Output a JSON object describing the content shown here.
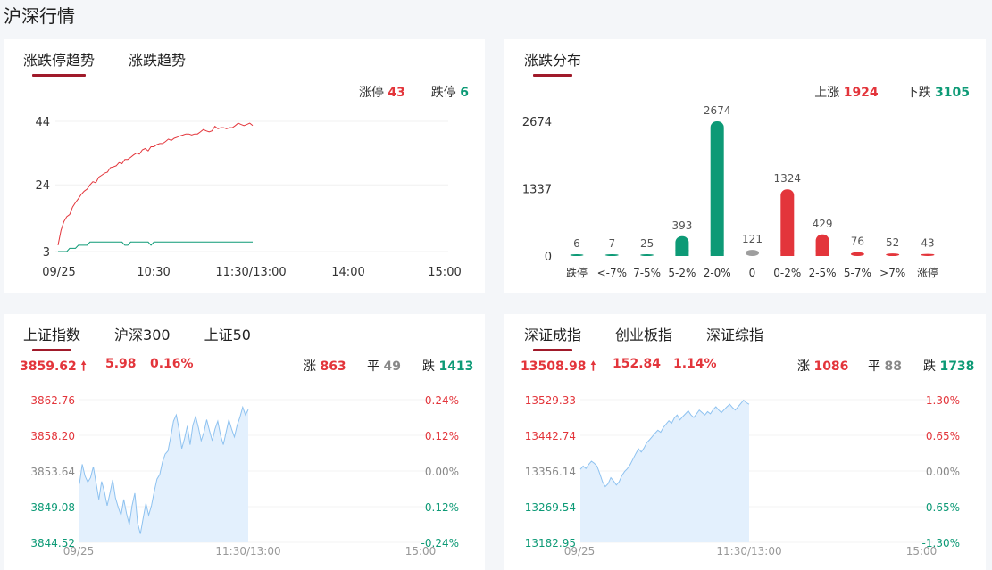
{
  "page": {
    "title": "沪深行情"
  },
  "colors": {
    "up": "#e3353b",
    "down": "#0d9a76",
    "flat": "#9e9e9e",
    "line_fill": "#e3f0fd",
    "line_stroke": "#8ec2f0"
  },
  "limit_panel": {
    "tabs": [
      {
        "label": "涨跌停趋势",
        "active": true
      },
      {
        "label": "涨跌趋势",
        "active": false
      }
    ],
    "legend": {
      "up_label": "涨停",
      "up_value": "43",
      "down_label": "跌停",
      "down_value": "6"
    },
    "chart_data": {
      "type": "line",
      "x_ticks": [
        "09/25",
        "10:30",
        "11:30/13:00",
        "14:00",
        "15:00"
      ],
      "y_ticks": [
        "44",
        "24",
        "3"
      ],
      "ylim": [
        3,
        44
      ],
      "series": [
        {
          "name": "涨停",
          "color": "#e3353b",
          "values": [
            5,
            10,
            12,
            14,
            15,
            17,
            18,
            20,
            21,
            22,
            23,
            24,
            25,
            25,
            26,
            27,
            28,
            28,
            29,
            30,
            30,
            31,
            31,
            32,
            32,
            33,
            33,
            34,
            34,
            35,
            35,
            35,
            36,
            36,
            37,
            37,
            37,
            38,
            38,
            38,
            39,
            39,
            39,
            40,
            40,
            40,
            40,
            40,
            40,
            41,
            41,
            41,
            41,
            41,
            42,
            42,
            42,
            42,
            42,
            42,
            42,
            43,
            43,
            43,
            43,
            43,
            43,
            43
          ]
        },
        {
          "name": "跌停",
          "color": "#0d9a76",
          "values": [
            3,
            3,
            3,
            3,
            4,
            4,
            4,
            5,
            5,
            5,
            5,
            6,
            6,
            6,
            6,
            6,
            6,
            6,
            6,
            6,
            6,
            6,
            6,
            5,
            5,
            6,
            6,
            6,
            6,
            6,
            6,
            6,
            5,
            6,
            6,
            6,
            6,
            6,
            6,
            6,
            6,
            6,
            6,
            6,
            6,
            6,
            6,
            6,
            6,
            6,
            6,
            6,
            6,
            6,
            6,
            6,
            6,
            6,
            6,
            6,
            6,
            6,
            6,
            6,
            6,
            6,
            6,
            6
          ]
        }
      ]
    }
  },
  "distribution_panel": {
    "tabs": [
      {
        "label": "涨跌分布",
        "active": true
      }
    ],
    "legend": {
      "up_label": "上涨",
      "up_value": "1924",
      "down_label": "下跌",
      "down_value": "3105"
    },
    "chart_data": {
      "type": "bar",
      "categories": [
        "跌停",
        "<-7%",
        "7-5%",
        "5-2%",
        "2-0%",
        "0",
        "0-2%",
        "2-5%",
        "5-7%",
        ">7%",
        "涨停"
      ],
      "values": [
        6,
        7,
        25,
        393,
        2674,
        121,
        1324,
        429,
        76,
        52,
        43
      ],
      "bar_colors": [
        "#0d9a76",
        "#0d9a76",
        "#0d9a76",
        "#0d9a76",
        "#0d9a76",
        "#9e9e9e",
        "#e3353b",
        "#e3353b",
        "#e3353b",
        "#e3353b",
        "#e3353b"
      ],
      "y_ticks": [
        "2674",
        "1337",
        "0"
      ],
      "ylim": [
        0,
        2674
      ]
    }
  },
  "sh_panel": {
    "tabs": [
      {
        "label": "上证指数",
        "active": true
      },
      {
        "label": "沪深300",
        "active": false
      },
      {
        "label": "上证50",
        "active": false
      }
    ],
    "price": "3859.62",
    "change": "5.98",
    "change_pct": "0.16%",
    "up_label": "涨",
    "up_count": "863",
    "flat_label": "平",
    "flat_count": "49",
    "down_label": "跌",
    "down_count": "1413",
    "chart_data": {
      "type": "area",
      "y_ticks_left": [
        "3862.76",
        "3858.20",
        "3853.64",
        "3849.08",
        "3844.52"
      ],
      "y_ticks_right": [
        "0.24%",
        "0.12%",
        "0.00%",
        "-0.12%",
        "-0.24%"
      ],
      "x_ticks": [
        "09/25",
        "11:30/13:00",
        "15:00"
      ],
      "ylim": [
        3844.52,
        3862.76
      ],
      "values": [
        3852.0,
        3854.5,
        3853.0,
        3852.2,
        3852.8,
        3854.2,
        3852.1,
        3850.0,
        3852.3,
        3851.0,
        3849.2,
        3850.8,
        3852.5,
        3850.2,
        3849.0,
        3848.0,
        3850.0,
        3848.2,
        3846.8,
        3849.2,
        3850.8,
        3847.0,
        3845.6,
        3847.6,
        3849.5,
        3848.0,
        3849.2,
        3851.0,
        3852.6,
        3853.2,
        3854.8,
        3855.8,
        3856.2,
        3858.0,
        3860.0,
        3860.8,
        3859.0,
        3856.5,
        3857.8,
        3859.4,
        3857.0,
        3859.5,
        3860.6,
        3859.2,
        3857.5,
        3858.6,
        3860.2,
        3858.8,
        3857.5,
        3859.0,
        3860.0,
        3858.2,
        3857.0,
        3858.6,
        3860.2,
        3859.0,
        3858.0,
        3859.5,
        3860.5,
        3861.8,
        3860.8,
        3861.5
      ]
    }
  },
  "sz_panel": {
    "tabs": [
      {
        "label": "深证成指",
        "active": true
      },
      {
        "label": "创业板指",
        "active": false
      },
      {
        "label": "深证综指",
        "active": false
      }
    ],
    "price": "13508.98",
    "change": "152.84",
    "change_pct": "1.14%",
    "up_label": "涨",
    "up_count": "1086",
    "flat_label": "平",
    "flat_count": "88",
    "down_label": "跌",
    "down_count": "1738",
    "chart_data": {
      "type": "area",
      "y_ticks_left": [
        "13529.33",
        "13442.74",
        "13356.14",
        "13269.54",
        "13182.95"
      ],
      "y_ticks_right": [
        "1.30%",
        "0.65%",
        "0.00%",
        "-0.65%",
        "-1.30%"
      ],
      "x_ticks": [
        "09/25",
        "11:30/13:00",
        "15:00"
      ],
      "ylim": [
        13182.95,
        13529.33
      ],
      "values": [
        13360,
        13368,
        13362,
        13372,
        13380,
        13375,
        13368,
        13350,
        13330,
        13318,
        13325,
        13340,
        13332,
        13322,
        13330,
        13345,
        13355,
        13362,
        13372,
        13385,
        13398,
        13410,
        13402,
        13412,
        13425,
        13432,
        13440,
        13448,
        13455,
        13450,
        13462,
        13470,
        13478,
        13472,
        13485,
        13492,
        13480,
        13488,
        13495,
        13502,
        13492,
        13486,
        13495,
        13504,
        13498,
        13492,
        13500,
        13495,
        13505,
        13512,
        13504,
        13498,
        13505,
        13512,
        13518,
        13510,
        13504,
        13512,
        13520,
        13528,
        13522,
        13518
      ]
    }
  }
}
